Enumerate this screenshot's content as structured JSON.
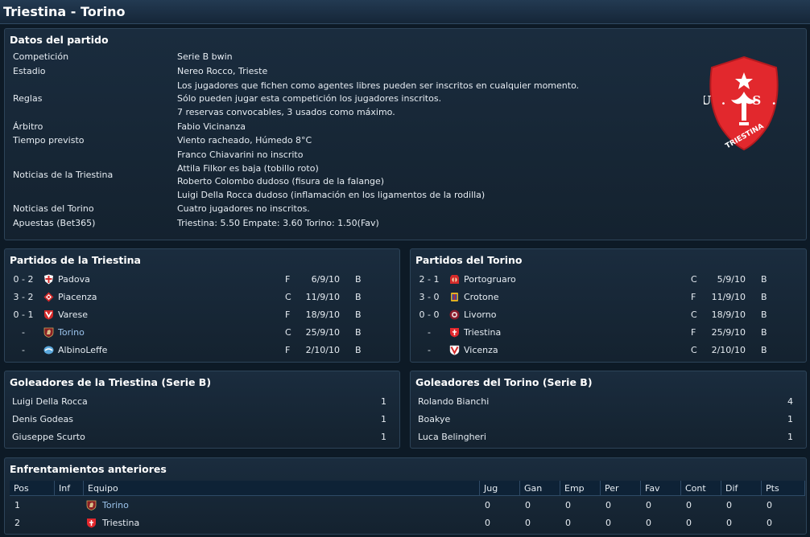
{
  "window": {
    "title": "Triestina - Torino"
  },
  "colors": {
    "accent_link": "#9cc3ec",
    "crest_red": "#e2282d",
    "background": "#0d1a26"
  },
  "match_details": {
    "title": "Datos del partido",
    "rows": [
      {
        "label": "Competición",
        "lines": [
          "Serie B bwin"
        ]
      },
      {
        "label": "Estadio",
        "lines": [
          "Nereo Rocco, Trieste"
        ]
      },
      {
        "label": "Reglas",
        "lines": [
          "Los jugadores que fichen como agentes libres pueden ser inscritos en cualquier momento.",
          "Sólo pueden jugar esta competición los jugadores inscritos.",
          "7 reservas convocables, 3 usados como máximo."
        ]
      },
      {
        "label": "Árbitro",
        "lines": [
          "Fabio Vicinanza"
        ]
      },
      {
        "label": "Tiempo previsto",
        "lines": [
          "Viento racheado, Húmedo 8°C"
        ]
      },
      {
        "label": "Noticias de la Triestina",
        "lines": [
          "Franco Chiavarini no inscrito",
          "Attila Filkor es baja (tobillo roto)",
          "Roberto Colombo dudoso (fisura de la falange)",
          "Luigi Della Rocca dudoso (inflamación en los ligamentos de la rodilla)"
        ]
      },
      {
        "label": "Noticias del Torino",
        "lines": [
          "Cuatro jugadores no inscritos."
        ]
      },
      {
        "label": "Apuestas (Bet365)",
        "lines": [
          "Triestina: 5.50  Empate: 3.60  Torino: 1.50(Fav)"
        ]
      }
    ],
    "crest_text": {
      "us": "U. S.",
      "name": "TRIESTINA"
    }
  },
  "home_fixtures": {
    "title": "Partidos de la Triestina",
    "rows": [
      {
        "score": "0 - 2",
        "team": "Padova",
        "venue": "F",
        "date": "6/9/10",
        "comp": "B",
        "crest": "padova-crest-icon",
        "link": false
      },
      {
        "score": "3 - 2",
        "team": "Piacenza",
        "venue": "C",
        "date": "11/9/10",
        "comp": "B",
        "crest": "piacenza-crest-icon",
        "link": false
      },
      {
        "score": "0 - 1",
        "team": "Varese",
        "venue": "F",
        "date": "18/9/10",
        "comp": "B",
        "crest": "varese-crest-icon",
        "link": false
      },
      {
        "score": "-",
        "team": "Torino",
        "venue": "C",
        "date": "25/9/10",
        "comp": "B",
        "crest": "torino-crest-icon",
        "link": true
      },
      {
        "score": "-",
        "team": "AlbinoLeffe",
        "venue": "F",
        "date": "2/10/10",
        "comp": "B",
        "crest": "albinoleffe-crest-icon",
        "link": false
      }
    ]
  },
  "away_fixtures": {
    "title": "Partidos del Torino",
    "rows": [
      {
        "score": "2 - 1",
        "team": "Portogruaro",
        "venue": "C",
        "date": "5/9/10",
        "comp": "B",
        "crest": "portogruaro-crest-icon",
        "link": false
      },
      {
        "score": "3 - 0",
        "team": "Crotone",
        "venue": "F",
        "date": "11/9/10",
        "comp": "B",
        "crest": "crotone-crest-icon",
        "link": false
      },
      {
        "score": "0 - 0",
        "team": "Livorno",
        "venue": "C",
        "date": "18/9/10",
        "comp": "B",
        "crest": "livorno-crest-icon",
        "link": false
      },
      {
        "score": "-",
        "team": "Triestina",
        "venue": "F",
        "date": "25/9/10",
        "comp": "B",
        "crest": "triestina-crest-icon",
        "link": false
      },
      {
        "score": "-",
        "team": "Vicenza",
        "venue": "C",
        "date": "2/10/10",
        "comp": "B",
        "crest": "vicenza-crest-icon",
        "link": false
      }
    ]
  },
  "home_scorers": {
    "title": "Goleadores de la Triestina (Serie B)",
    "rows": [
      {
        "name": "Luigi Della Rocca",
        "goals": "1"
      },
      {
        "name": "Denis Godeas",
        "goals": "1"
      },
      {
        "name": "Giuseppe Scurto",
        "goals": "1"
      }
    ]
  },
  "away_scorers": {
    "title": "Goleadores del Torino (Serie B)",
    "rows": [
      {
        "name": "Rolando Bianchi",
        "goals": "4"
      },
      {
        "name": "Boakye",
        "goals": "1"
      },
      {
        "name": "Luca Belingheri",
        "goals": "1"
      }
    ]
  },
  "head_to_head": {
    "title": "Enfrentamientos anteriores",
    "columns": [
      "Pos",
      "Inf",
      "Equipo",
      "Jug",
      "Gan",
      "Emp",
      "Per",
      "Fav",
      "Cont",
      "Dif",
      "Pts"
    ],
    "rows": [
      {
        "pos": "1",
        "inf": "",
        "team": "Torino",
        "link": true,
        "crest": "torino-crest-icon",
        "jug": "0",
        "gan": "0",
        "emp": "0",
        "per": "0",
        "fav": "0",
        "cont": "0",
        "dif": "0",
        "pts": "0"
      },
      {
        "pos": "2",
        "inf": "",
        "team": "Triestina",
        "link": false,
        "crest": "triestina-crest-icon",
        "jug": "0",
        "gan": "0",
        "emp": "0",
        "per": "0",
        "fav": "0",
        "cont": "0",
        "dif": "0",
        "pts": "0"
      }
    ]
  }
}
